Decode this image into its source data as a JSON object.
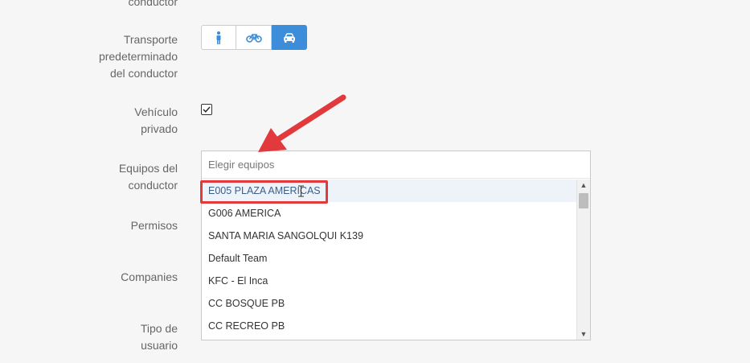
{
  "form": {
    "label_top_partial": "conductor",
    "label_transport": "Transporte predeterminado del conductor",
    "label_vehicle": "Vehículo privado",
    "label_teams": "Equipos del conductor",
    "label_permissions": "Permisos",
    "label_companies": "Companies",
    "label_user_type": "Tipo de usuario"
  },
  "transport": {
    "options": [
      {
        "icon": "walking-icon"
      },
      {
        "icon": "bicycle-icon"
      },
      {
        "icon": "car-icon",
        "selected": true
      }
    ],
    "accent_color": "#3c8dda"
  },
  "vehicle": {
    "checked": true
  },
  "teams_select": {
    "placeholder": "Elegir equipos",
    "options": [
      "E005 PLAZA AMERICAS",
      "G006 AMERICA",
      "SANTA MARIA SANGOLQUI K139",
      "Default Team",
      "KFC - El Inca",
      "CC BOSQUE PB",
      "CC RECREO PB"
    ],
    "hovered_index": 0
  },
  "annotation": {
    "color": "#e2393d"
  }
}
